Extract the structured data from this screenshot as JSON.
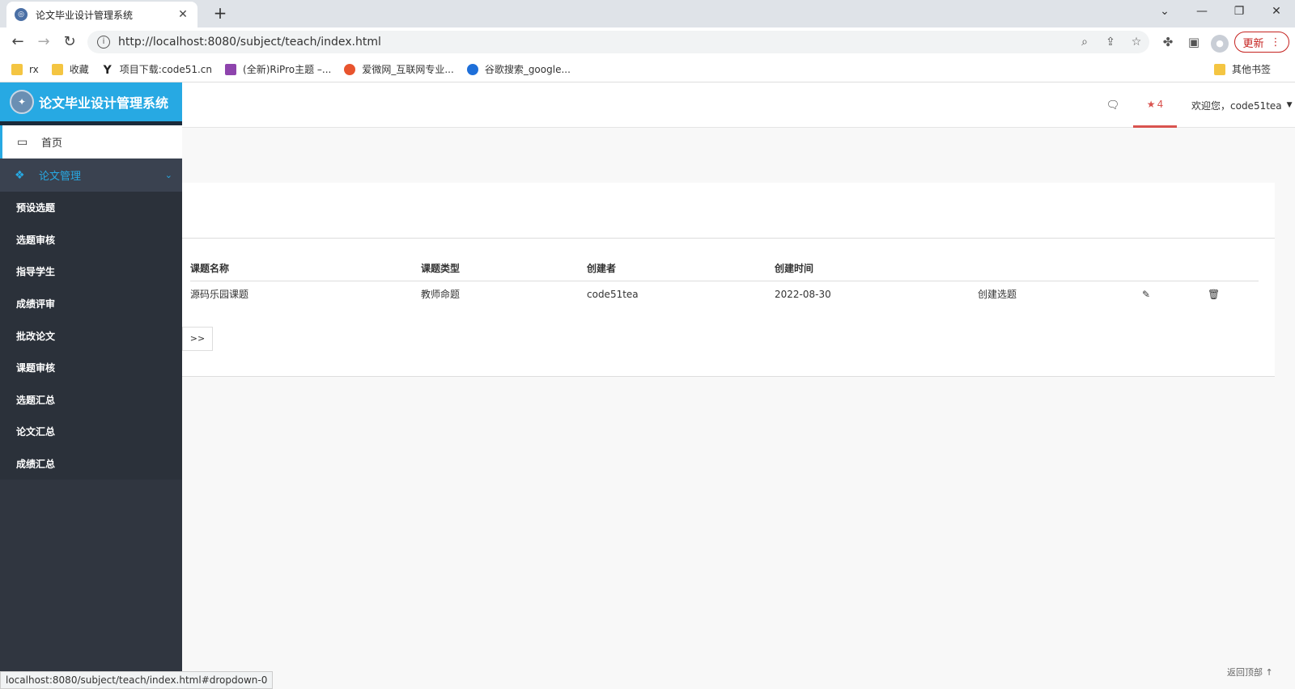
{
  "browser": {
    "tab_title": "论文毕业设计管理系统",
    "tab_close": "✕",
    "new_tab": "+",
    "url": "http://localhost:8080/subject/teach/index.html",
    "update_label": "更新",
    "status_url": "localhost:8080/subject/teach/index.html#dropdown-0",
    "bookmarks": [
      {
        "label": "rx",
        "icon": "folder-icon"
      },
      {
        "label": "收藏",
        "icon": "folder-icon"
      },
      {
        "label": "项目下载:code51.cn",
        "icon": "y-icon"
      },
      {
        "label": "(全新)RiPro主题 –...",
        "icon": "ripro-icon"
      },
      {
        "label": "爱微网_互联网专业...",
        "icon": "aiwei-icon"
      },
      {
        "label": "谷歌搜索_google...",
        "icon": "search360-icon"
      }
    ],
    "other_bookmarks": "其他书签"
  },
  "app": {
    "brand": "论文毕业设计管理系统",
    "menu_home": "首页",
    "menu_group": "论文管理",
    "submenu": [
      "预设选题",
      "选题审核",
      "指导学生",
      "成绩评审",
      "批改论文",
      "课题审核",
      "选题汇总",
      "论文汇总",
      "成绩汇总"
    ],
    "topbar": {
      "star_count": "4",
      "welcome": "欢迎您，code51tea"
    },
    "table": {
      "headers": [
        "课题名称",
        "课题类型",
        "创建者",
        "创建时间"
      ],
      "rows": [
        {
          "name": "源码乐园课题",
          "type": "教师命题",
          "creator": "code51tea",
          "created": "2022-08-30",
          "action": "创建选题"
        }
      ]
    },
    "pager_next": ">>",
    "back_to_top": "返回顶部"
  }
}
